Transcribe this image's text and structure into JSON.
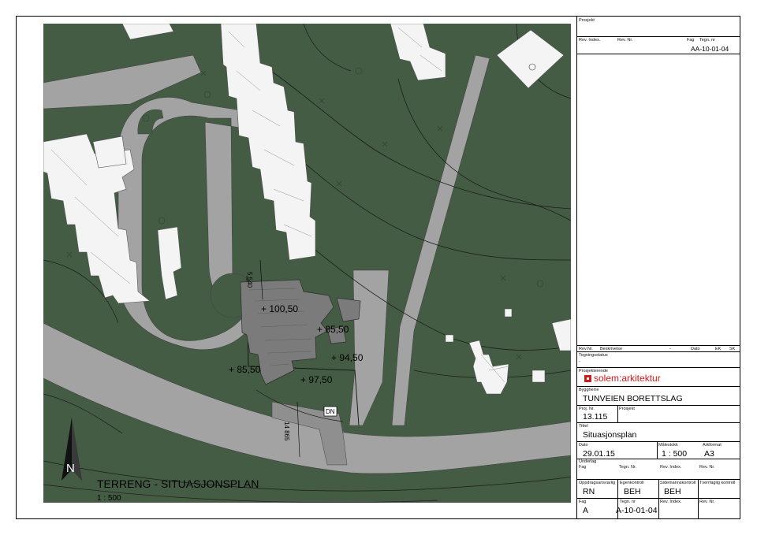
{
  "map": {
    "elevations": [
      "+ 100,50",
      "+ 85,50",
      "+ 94,50",
      "+ 85,50",
      "+ 97,50"
    ],
    "dims": [
      "5 540",
      "14 865"
    ],
    "dn_label": "DN",
    "north_letter": "N",
    "drawing_title": "TERRENG - SITUASJONSPLAN",
    "drawing_scale": "1 : 500"
  },
  "titleblock": {
    "prosjekt_label": "Prosjekt",
    "rev_index_label": "Rev. Index.",
    "rev_nr_label": "Rev. Nr.",
    "fag_label": "Fag",
    "tegn_nr_label": "Tegn. nr",
    "top_drawing_number": "AA-10-01-04",
    "rev_table": {
      "rev_nr": "Rev.Nr.",
      "beskrivelse": "Beskrivelse",
      "dash": "-",
      "dato": "Dato",
      "ek": "EK",
      "sk": "SK"
    },
    "tegningsstatus_label": "Tegningsstatus",
    "tegningsstatus_value": "-",
    "prosjekterende_label": "Prosjekterende",
    "firm": "solem:arkitektur",
    "byggherre_label": "Byggherre",
    "byggherre": "TUNVEIEN BORETTSLAG",
    "proj_nr_label": "Proj. Nr.",
    "proj_nr": "13.115",
    "prosjekt_label2": "Prosjekt",
    "tittel_label": "Tittel",
    "tittel": "Situasjonsplan",
    "dato_label": "Dato",
    "dato": "29.01.15",
    "malestokk_label": "Målestokk",
    "malestokk": "1 : 500",
    "arkformat_label": "Arkformat",
    "arkformat": "A3",
    "underlag_label": "Underlag",
    "underlag_fag": "Fag",
    "underlag_tegn_nr": "Tegn. Nr.",
    "underlag_rev_index": "Rev. Index.",
    "underlag_rev_nr": "Rev. Nr.",
    "oppdragsansvarlig_label": "Oppdragsansvarlig",
    "oppdragsansvarlig": "RN",
    "egenkontroll_label": "Egenkontroll",
    "egenkontroll": "BEH",
    "sidemannskontroll_label": "Sidemannskontroll",
    "sidemannskontroll": "BEH",
    "tverrfaglig_label": "Tverrfaglig kontroll",
    "bottom_fag_label": "Fag",
    "bottom_tegn_nr_label": "Tegn. nr",
    "bottom_rev_index_label": "Rev. Index.",
    "bottom_rev_nr_label": "Rev. Nr.",
    "bottom_fag": "A",
    "bottom_tegn_nr": "A-10-01-04"
  },
  "colors": {
    "terrain": "#445c43",
    "road": "#a3a3a3",
    "building_existing": "#f5f5f5",
    "building_new": "#7b7b7b",
    "brand": "#d01b1b"
  }
}
